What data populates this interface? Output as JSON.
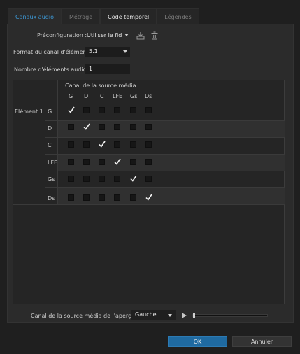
{
  "tabs": [
    {
      "label": "Canaux audio",
      "state": "active"
    },
    {
      "label": "Métrage",
      "state": "inactive"
    },
    {
      "label": "Code temporel",
      "state": "bold"
    },
    {
      "label": "Légendes",
      "state": "inactive"
    }
  ],
  "preset": {
    "label": "Préconfiguration :",
    "value": "Utiliser le fid",
    "icons": [
      "import-preset-icon",
      "delete-preset-icon"
    ]
  },
  "clip_channel_format": {
    "label": "Format du canal d'élément :",
    "value": "5.1"
  },
  "audio_clip_count": {
    "label": "Nombre d'éléments audio :",
    "value": "1"
  },
  "matrix": {
    "header": "Canal de la source média :",
    "source_channels": [
      "G",
      "D",
      "C",
      "LFE",
      "Gs",
      "Ds"
    ],
    "clip_label": "Elément 1",
    "rows": [
      {
        "channel": "G",
        "checked": [
          true,
          false,
          false,
          false,
          false,
          false
        ]
      },
      {
        "channel": "D",
        "checked": [
          false,
          true,
          false,
          false,
          false,
          false
        ]
      },
      {
        "channel": "C",
        "checked": [
          false,
          false,
          true,
          false,
          false,
          false
        ]
      },
      {
        "channel": "LFE",
        "checked": [
          false,
          false,
          false,
          true,
          false,
          false
        ]
      },
      {
        "channel": "Gs",
        "checked": [
          false,
          false,
          false,
          false,
          true,
          false
        ]
      },
      {
        "channel": "Ds",
        "checked": [
          false,
          false,
          false,
          false,
          false,
          true
        ]
      }
    ]
  },
  "preview": {
    "label": "Canal de la source média de l'aperçu :",
    "value": "Gauche"
  },
  "buttons": {
    "ok": "OK",
    "cancel": "Annuler"
  },
  "colors": {
    "accent": "#3d9ad8",
    "ok_button": "#1f6aa1"
  }
}
